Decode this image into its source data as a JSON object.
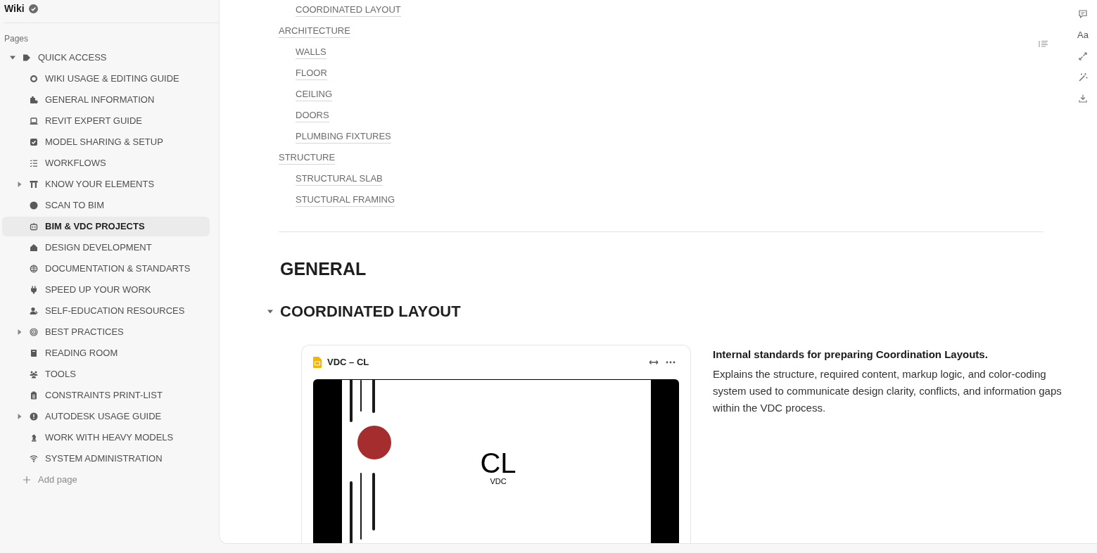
{
  "sidebar": {
    "title": "Wiki",
    "section_label": "Pages",
    "pages": [
      {
        "label": "QUICK ACCESS",
        "selected": false,
        "expanded": true,
        "children": [
          {
            "label": "WIKI USAGE & EDITING GUIDE",
            "selected": false
          },
          {
            "label": "GENERAL INFORMATION",
            "selected": false
          },
          {
            "label": "REVIT EXPERT GUIDE",
            "selected": false
          },
          {
            "label": "MODEL SHARING & SETUP",
            "selected": false
          },
          {
            "label": "WORKFLOWS",
            "selected": false
          },
          {
            "label": "KNOW YOUR ELEMENTS",
            "selected": false,
            "expanded": false
          },
          {
            "label": "SCAN TO BIM",
            "selected": false
          },
          {
            "label": "BIM & VDC PROJECTS",
            "selected": true
          },
          {
            "label": "DESIGN DEVELOPMENT",
            "selected": false
          },
          {
            "label": "DOCUMENTATION & STANDARTS",
            "selected": false
          },
          {
            "label": "SPEED UP YOUR WORK",
            "selected": false
          },
          {
            "label": "SELF-EDUCATION RESOURCES",
            "selected": false
          },
          {
            "label": "BEST PRACTICES",
            "selected": false,
            "expanded": false
          },
          {
            "label": "READING ROOM",
            "selected": false
          },
          {
            "label": "TOOLS",
            "selected": false
          },
          {
            "label": "CONSTRAINTS PRINT-LIST",
            "selected": false
          },
          {
            "label": "AUTODESK USAGE GUIDE",
            "selected": false,
            "expanded": false
          },
          {
            "label": "WORK WITH HEAVY MODELS",
            "selected": false
          },
          {
            "label": "SYSTEM ADMINISTRATION",
            "selected": false
          }
        ]
      }
    ],
    "add_page": "Add page"
  },
  "outline": [
    {
      "children": [
        {
          "label": "COORDINATED LAYOUT"
        }
      ]
    },
    {
      "label": "ARCHITECTURE",
      "children": [
        {
          "label": "WALLS"
        },
        {
          "label": "FLOOR"
        },
        {
          "label": "CEILING"
        },
        {
          "label": "DOORS"
        },
        {
          "label": "PLUMBING FIXTURES"
        }
      ]
    },
    {
      "label": "STRUCTURE",
      "children": [
        {
          "label": "STRUCTURAL SLAB"
        },
        {
          "label": "STUCTURAL FRAMING"
        }
      ]
    }
  ],
  "heading": "GENERAL",
  "section": {
    "title": "COORDINATED LAYOUT",
    "expanded": true
  },
  "embed": {
    "title": "VDC – CL",
    "slide": {
      "title": "CL",
      "subtitle": "VDC"
    }
  },
  "description": {
    "title": "Internal standards for preparing Coordination Layouts.",
    "text": "Explains the structure, required content, markup logic, and color-coding system used to communicate design clarity, conflicts, and information gaps within the VDC process."
  },
  "toolbar": {
    "font_label": "Aa"
  }
}
